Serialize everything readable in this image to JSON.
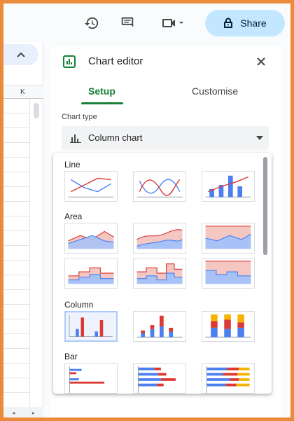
{
  "toolbar": {
    "history_icon": "history-icon",
    "comment_icon": "comment-icon",
    "video_icon": "videocam-icon",
    "share_label": "Share",
    "share_icon": "lock-icon",
    "colors": {
      "share_bg": "#c2e7ff"
    }
  },
  "sheet": {
    "column_header": "K",
    "collapse_icon": "chevron-up-icon"
  },
  "editor": {
    "title": "Chart editor",
    "tabs": [
      {
        "label": "Setup",
        "active": true
      },
      {
        "label": "Customise",
        "active": false
      }
    ],
    "chart_type_label": "Chart type",
    "chart_type_value": "Column chart",
    "colors": {
      "accent": "#188038",
      "series_blue": "#4c80f1",
      "series_red": "#db3a34",
      "series_yellow": "#f4b400"
    }
  },
  "dropdown": {
    "sections": [
      {
        "label": "Line",
        "options": [
          "line-chart",
          "smooth-line-chart",
          "combo-chart"
        ]
      },
      {
        "label": "Area",
        "options": [
          "area-chart",
          "smooth-area-chart",
          "100-percent-area-chart",
          "stepped-area-chart",
          "stacked-stepped-area-chart",
          "100-percent-stepped-area-chart"
        ]
      },
      {
        "label": "Column",
        "options": [
          "column-chart",
          "stacked-column-chart",
          "100-percent-stacked-column-chart"
        ],
        "selected": "column-chart"
      },
      {
        "label": "Bar",
        "options": [
          "bar-chart",
          "stacked-bar-chart",
          "100-percent-stacked-bar-chart"
        ]
      }
    ]
  }
}
